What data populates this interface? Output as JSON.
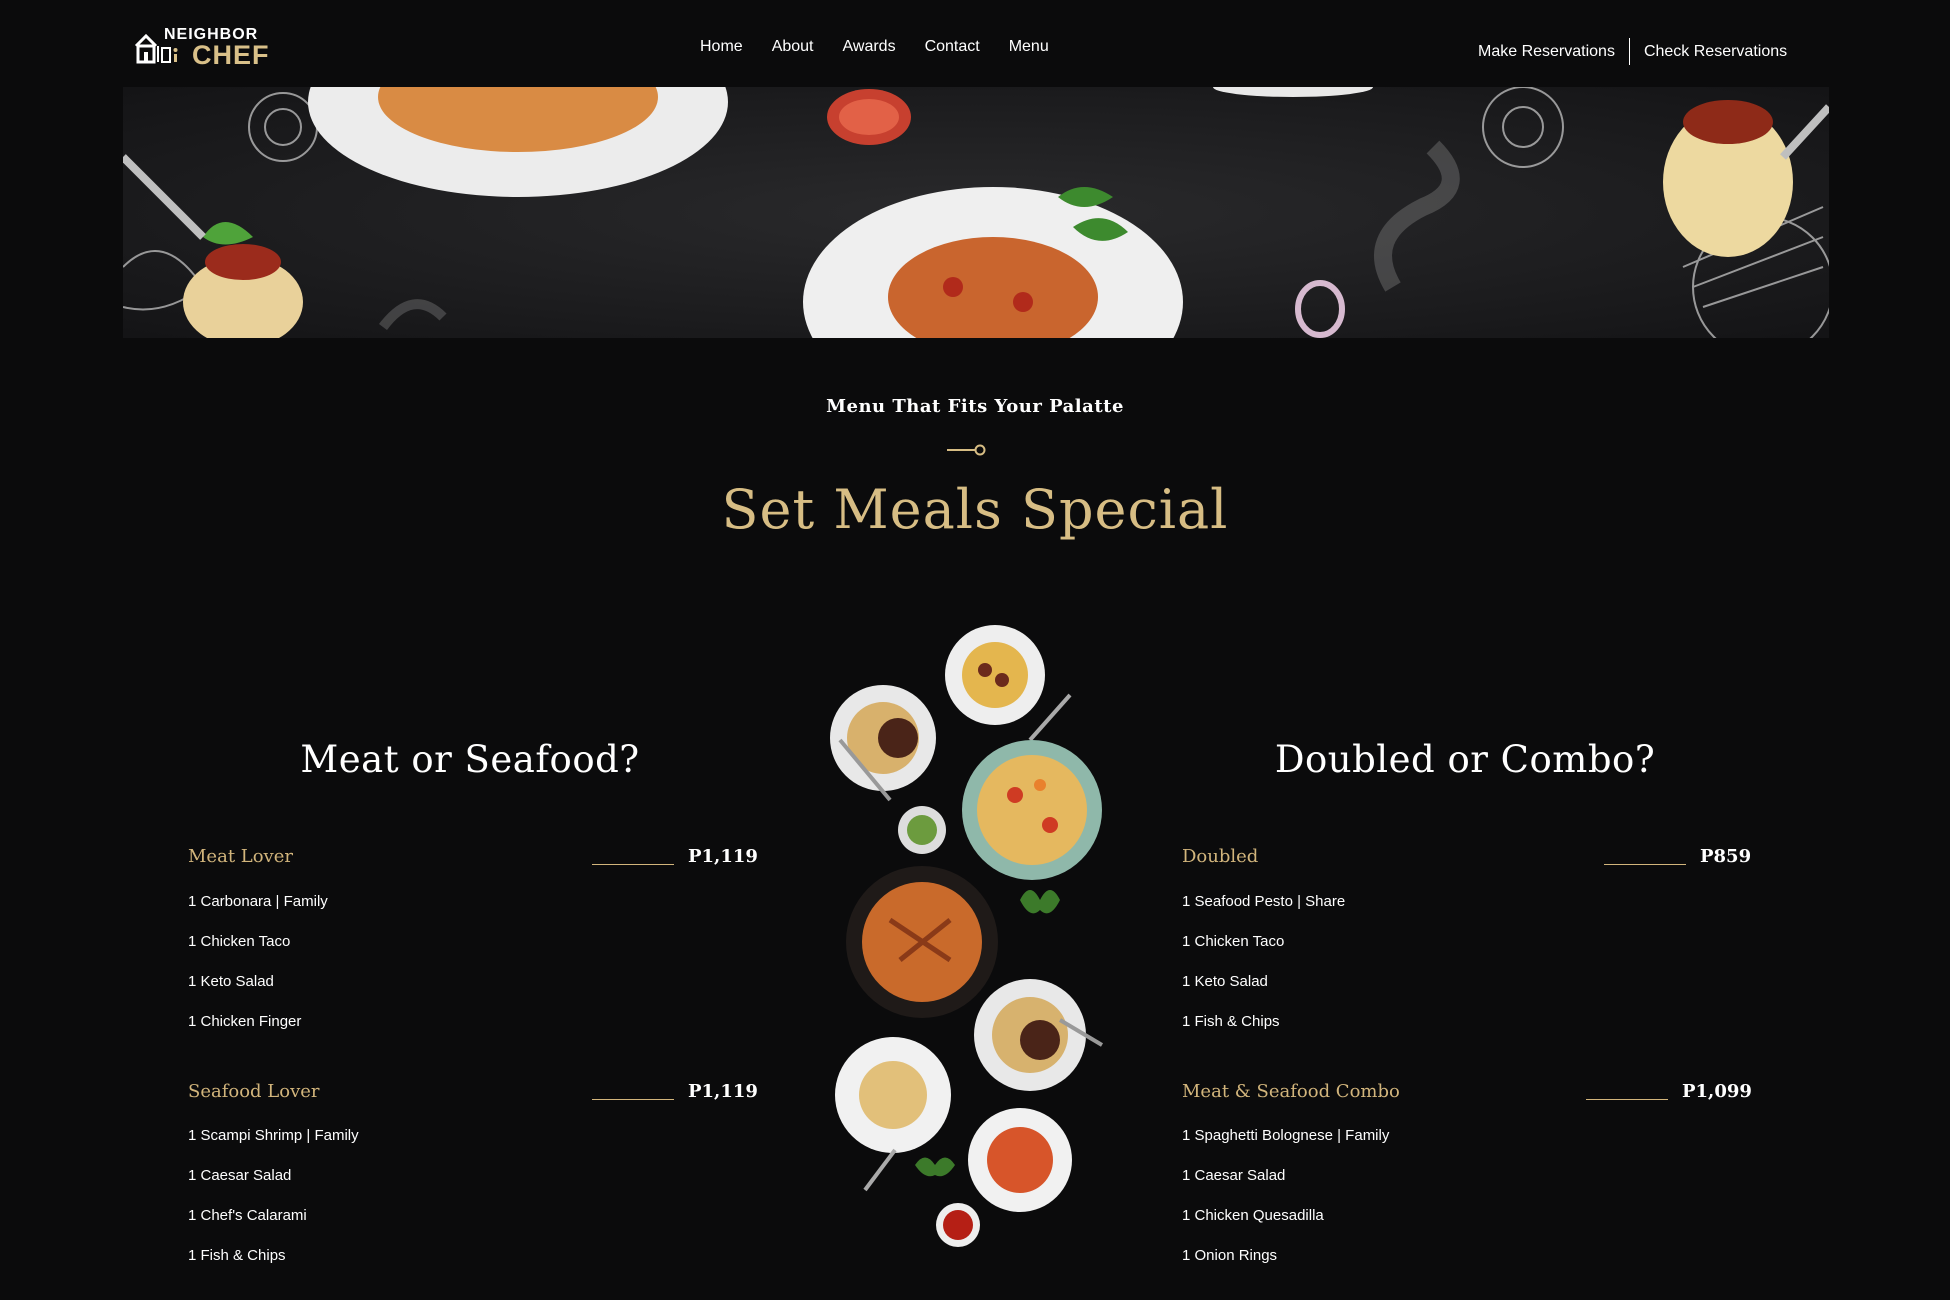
{
  "header": {
    "logo_top": "NEIGHBOR",
    "logo_bottom": "CHEF",
    "nav": [
      "Home",
      "About",
      "Awards",
      "Contact",
      "Menu"
    ],
    "make_reservations": "Make Reservations",
    "check_reservations": "Check Reservations"
  },
  "section": {
    "subtitle": "Menu That Fits Your Palatte",
    "title": "Set Meals Special"
  },
  "left": {
    "title": "Meat or Seafood?",
    "groups": [
      {
        "name": "Meat Lover",
        "price": "P1,119",
        "items": [
          "1 Carbonara | Family",
          "1 Chicken Taco",
          "1 Keto Salad",
          "1 Chicken Finger"
        ]
      },
      {
        "name": "Seafood Lover",
        "price": "P1,119",
        "items": [
          "1 Scampi Shrimp | Family",
          "1 Caesar Salad",
          "1 Chef's Calarami",
          "1 Fish & Chips"
        ]
      }
    ]
  },
  "right": {
    "title": "Doubled or Combo?",
    "groups": [
      {
        "name": "Doubled",
        "price": "P859",
        "items": [
          "1 Seafood Pesto | Share",
          "1 Chicken Taco",
          "1 Keto Salad",
          "1 Fish & Chips"
        ]
      },
      {
        "name": "Meat & Seafood Combo",
        "price": "P1,099",
        "items": [
          "1 Spaghetti Bolognese | Family",
          "1 Caesar Salad",
          "1 Chicken Quesadilla",
          "1 Onion Rings"
        ]
      }
    ]
  },
  "colors": {
    "gold": "#d7bd84",
    "background": "#0b0b0c"
  },
  "icons": [
    "logo-chef-house-icon",
    "fork-divider-icon"
  ]
}
